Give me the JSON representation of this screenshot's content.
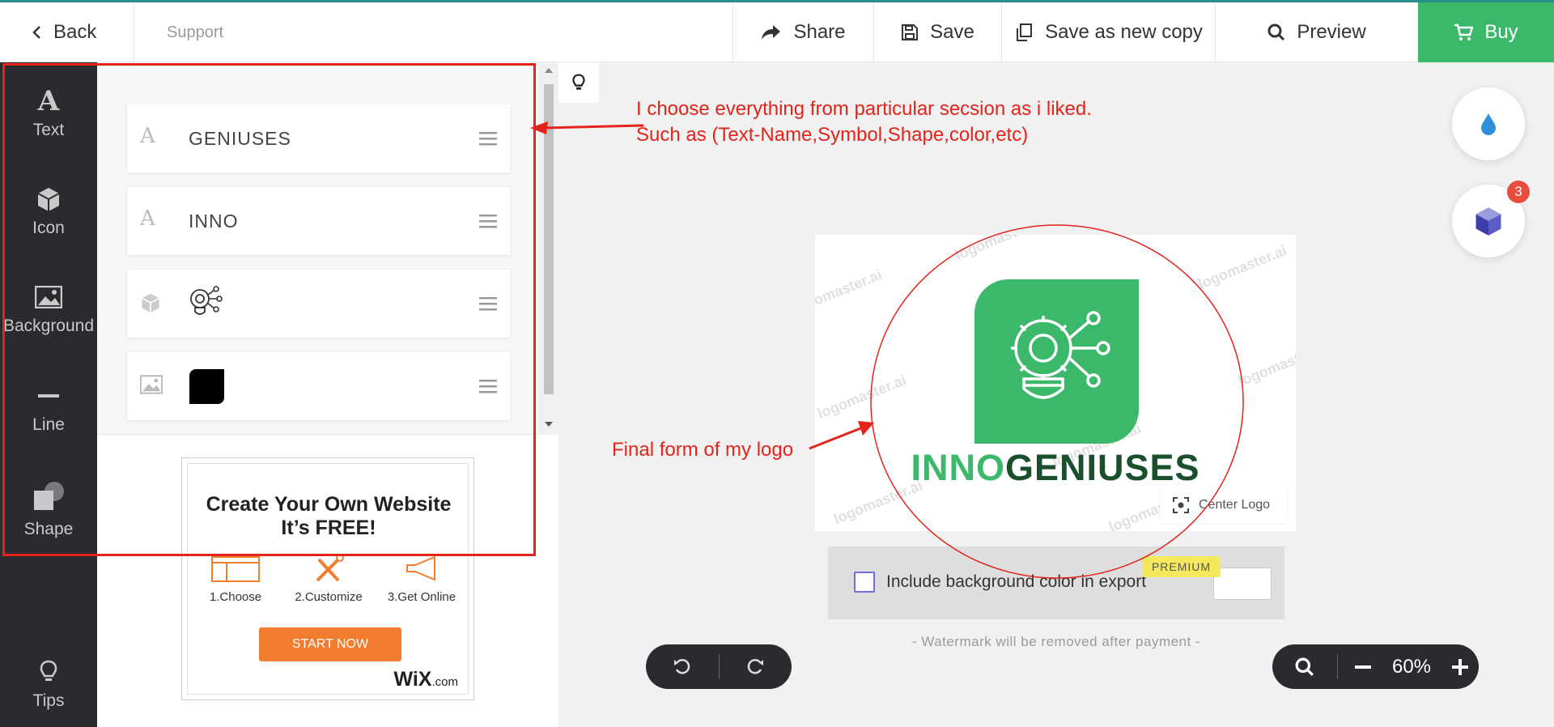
{
  "topbar": {
    "back_label": "Back",
    "support_label": "Support",
    "share_label": "Share",
    "save_label": "Save",
    "save_copy_label": "Save as new copy",
    "preview_label": "Preview",
    "buy_label": "Buy",
    "buy_color": "#3cb86b"
  },
  "rail": {
    "items": [
      {
        "label": "Text",
        "icon": "text-icon"
      },
      {
        "label": "Icon",
        "icon": "cube-icon"
      },
      {
        "label": "Background",
        "icon": "image-icon"
      },
      {
        "label": "Line",
        "icon": "line-icon"
      },
      {
        "label": "Shape",
        "icon": "shape-icon"
      }
    ],
    "tips_label": "Tips"
  },
  "layers": [
    {
      "type": "text",
      "label": "GENIUSES"
    },
    {
      "type": "text",
      "label": "INNO"
    },
    {
      "type": "icon",
      "label": ""
    },
    {
      "type": "background",
      "label": ""
    }
  ],
  "ad": {
    "title_line1": "Create Your Own Website",
    "title_line2": "It’s FREE!",
    "steps": [
      "1.Choose",
      "2.Customize",
      "3.Get Online"
    ],
    "cta": "START NOW",
    "brand": "WiX",
    "brand_suffix": ".com"
  },
  "canvas": {
    "brand_part1": "INNO",
    "brand_part2": "GENIUSES",
    "watermark": "logomaster.ai",
    "center_logo_label": "Center Logo",
    "include_bg_label": "Include background color in export",
    "premium_label": "PREMIUM",
    "watermark_note": "- Watermark will be removed after payment -",
    "zoom": "60%",
    "badge_count": "3",
    "accent": "#3cb86b",
    "dark_green": "#1a4f2c"
  },
  "annotations": {
    "line1": "I choose everything from particular secsion as i liked.",
    "line2": "Such as (Text-Name,Symbol,Shape,color,etc)",
    "final": "Final form of my logo",
    "color": "#e4231b"
  }
}
